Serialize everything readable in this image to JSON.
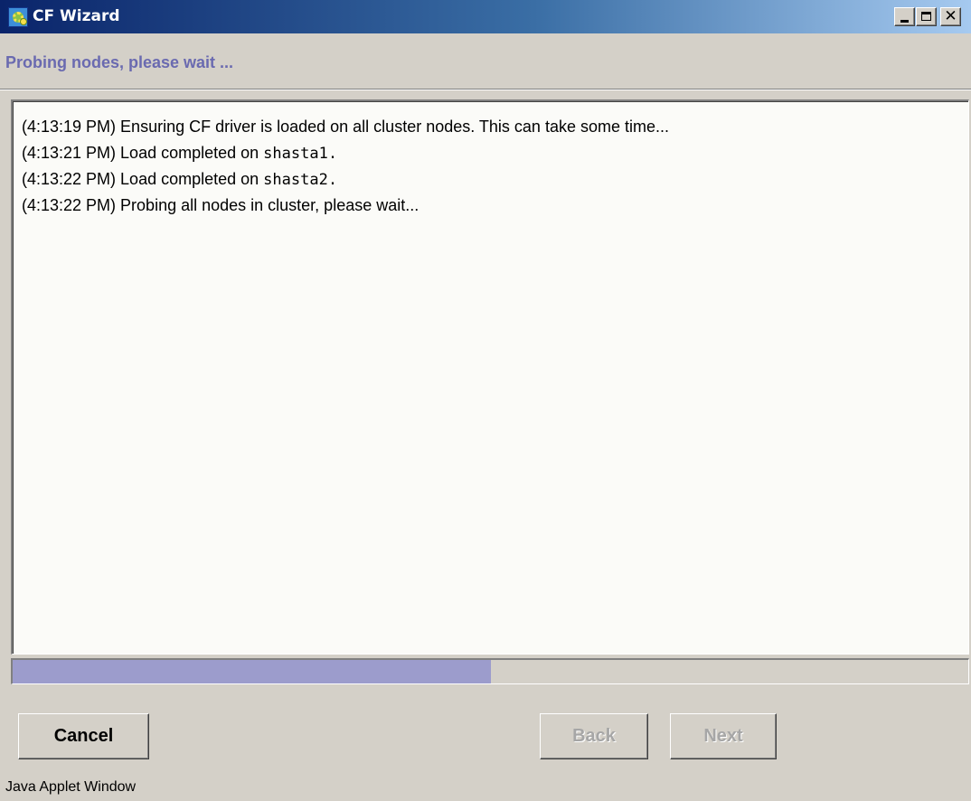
{
  "window": {
    "title": "CF Wizard",
    "icon": "cf-wizard-app-icon",
    "controls": {
      "minimize_icon": "minimize-icon",
      "maximize_icon": "maximize-icon",
      "close_icon": "close-icon",
      "close_glyph": "✕"
    }
  },
  "header": {
    "subtitle": "Probing nodes, please wait ..."
  },
  "log": {
    "lines": [
      {
        "text": "(4:13:19 PM) Ensuring CF driver is loaded on all cluster nodes. This can take some time...",
        "node": ""
      },
      {
        "text": "(4:13:21 PM) Load completed on ",
        "node": "shasta1."
      },
      {
        "text": "(4:13:22 PM) Load completed on ",
        "node": "shasta2."
      },
      {
        "text": "(4:13:22 PM) Probing all nodes in cluster, please wait...",
        "node": ""
      }
    ]
  },
  "progress": {
    "fraction": 0.5
  },
  "buttons": {
    "cancel": "Cancel",
    "back": "Back",
    "next": "Next"
  },
  "status": {
    "text": "Java Applet Window"
  },
  "colors": {
    "subtitle": "#6a6ab0",
    "progress_fill": "#9c9ccc",
    "titlebar_start": "#0a246a",
    "titlebar_end": "#a6caf0"
  }
}
